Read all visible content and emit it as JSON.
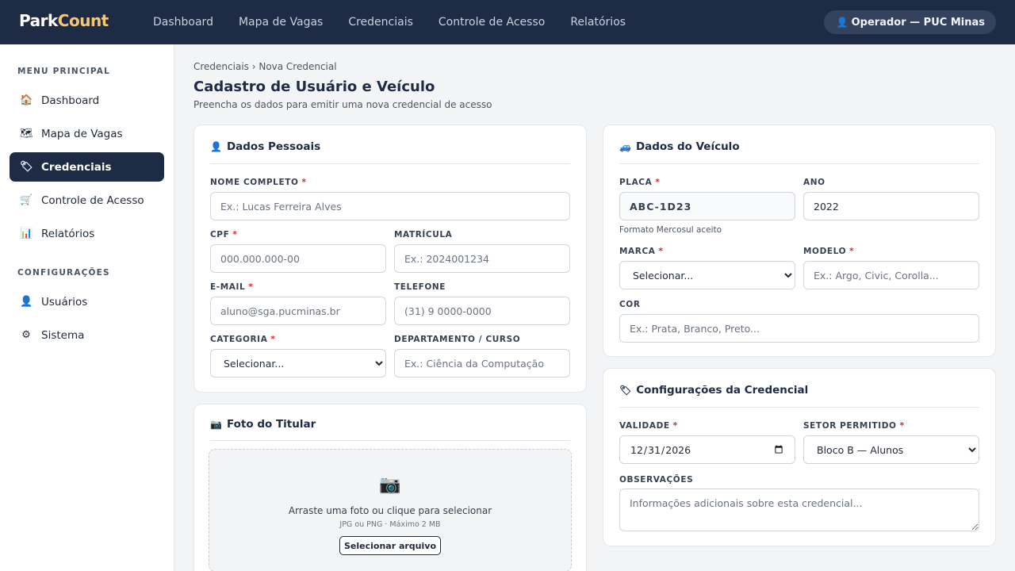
{
  "app": {
    "logo_part1": "Park",
    "logo_part2": "Count"
  },
  "topnav": {
    "items": [
      "Dashboard",
      "Mapa de Vagas",
      "Credenciais",
      "Controle de Acesso",
      "Relatórios"
    ],
    "user_label": "Operador — PUC Minas"
  },
  "sidebar": {
    "section_main": "MENU PRINCIPAL",
    "main_items": [
      {
        "label": "Dashboard",
        "icon": "house-icon"
      },
      {
        "label": "Mapa de Vagas",
        "icon": "map-icon"
      },
      {
        "label": "Credenciais",
        "icon": "credential-icon",
        "active": true
      },
      {
        "label": "Controle de Acesso",
        "icon": "cart-icon"
      },
      {
        "label": "Relatórios",
        "icon": "chart-icon"
      }
    ],
    "section_config": "CONFIGURAÇÕES",
    "config_items": [
      {
        "label": "Usuários",
        "icon": "user-icon"
      },
      {
        "label": "Sistema",
        "icon": "gear-icon"
      }
    ]
  },
  "page": {
    "breadcrumb": "Credenciais › Nova Credencial",
    "title": "Cadastro de Usuário e Veículo",
    "subtitle": "Preencha os dados para emitir uma nova credencial de acesso"
  },
  "personal": {
    "title": "Dados Pessoais",
    "name_label": "NOME COMPLETO",
    "name_placeholder": "Ex.: Lucas Ferreira Alves",
    "cpf_label": "CPF",
    "cpf_placeholder": "000.000.000-00",
    "matricula_label": "MATRÍCULA",
    "matricula_placeholder": "Ex.: 2024001234",
    "email_label": "E-MAIL",
    "email_placeholder": "aluno@sga.pucminas.br",
    "phone_label": "TELEFONE",
    "phone_placeholder": "(31) 9 0000-0000",
    "category_label": "CATEGORIA",
    "category_value": "Selecionar...",
    "dept_label": "DEPARTAMENTO / CURSO",
    "dept_placeholder": "Ex.: Ciência da Computação"
  },
  "photo": {
    "title": "Foto do Titular",
    "drop_text": "Arraste uma foto ou clique para selecionar",
    "drop_hint": "JPG ou PNG · Máximo 2 MB",
    "button": "Selecionar arquivo"
  },
  "vehicle": {
    "title": "Dados do Veículo",
    "plate_label": "PLACA",
    "plate_value": "ABC-1D23",
    "plate_hint": "Formato Mercosul aceito",
    "year_label": "ANO",
    "year_value": "2022",
    "brand_label": "MARCA",
    "brand_value": "Selecionar...",
    "model_label": "MODELO",
    "model_placeholder": "Ex.: Argo, Civic, Corolla...",
    "color_label": "COR",
    "color_placeholder": "Ex.: Prata, Branco, Preto..."
  },
  "credential": {
    "title": "Configurações da Credencial",
    "validity_label": "VALIDADE",
    "validity_value": "2026-12-31",
    "sector_label": "SETOR PERMITIDO",
    "sector_value": "Bloco B — Alunos",
    "notes_label": "OBSERVAÇÕES",
    "notes_placeholder": "Informações adicionais sobre esta credencial..."
  },
  "required_mark": "*",
  "colors": {
    "navy": "#1e2b45",
    "accent": "#f3c77a",
    "required": "#dc2626"
  }
}
